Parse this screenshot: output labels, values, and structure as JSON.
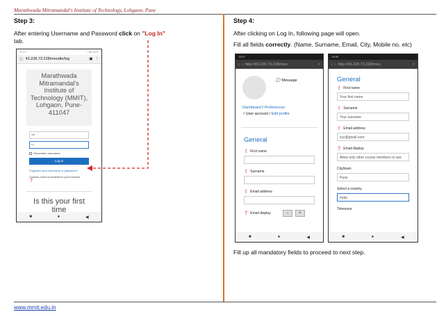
{
  "header": {
    "institute": "Marathwada Mitramandal's Institute of Technology, Lohgaon, Pune"
  },
  "footer": {
    "link": "www.mmit.edu.in"
  },
  "step3": {
    "title": "Step 3:",
    "text_pre": "After entering Username and Password ",
    "text_click": "click",
    "text_on": " on ",
    "text_login": "\"Log In\"",
    "text_post": " tab."
  },
  "step4": {
    "title": "Step 4:",
    "line1": "After clicking on Log In, following page will open.",
    "line2_pre": "Fill all fields ",
    "line2_bold": "correctly",
    "line2_post": ". (Name, Surname, Email, City, Mobile no. etc)",
    "bottom_note": "Fill up all mandatory fields to proceed to next step."
  },
  "phone1": {
    "status_time": "12:11",
    "status_right": "↑ ▮ 100%",
    "url": "43.228.73.228/moodle/log",
    "school": [
      "Marathwada",
      "Mitramandal's",
      "Institute of",
      "Technology (MMIT),",
      "Lohgaon, Pune-",
      "411047"
    ],
    "username_value": "mit",
    "password_value": "••|",
    "remember_label": "Remember username",
    "login_button": "Log in",
    "forgot_link": "Forgotten your username or password?",
    "cookie_note": "Cookies must be enabled in your browser",
    "first_time": "Is this your first time"
  },
  "phone2": {
    "status_time": "13:37",
    "url": "http://43.228.73.228/moo",
    "message_label": "Message",
    "breadcrumb": [
      "Dashboard",
      "Preferences",
      "User account",
      "Edit profile"
    ],
    "section": "General",
    "fields": [
      "First name",
      "Surname",
      "Email address",
      "Email display"
    ]
  },
  "phone3": {
    "status_time": "13:39",
    "url": "http://43.228.73.228/moo",
    "section": "General",
    "first_name_label": "First name",
    "first_name_value": "Your first name",
    "surname_label": "Surname",
    "surname_value": "Your surname",
    "email_label": "Email address",
    "email_value": "xyz@gmail.com",
    "display_label": "Email display",
    "display_value": "Allow only other course members to see",
    "city_label": "City/town",
    "city_value": "Pune",
    "country_label": "Select a country",
    "country_value": "India",
    "timezone_label": "Timezone"
  },
  "nav": {
    "back": "◀",
    "home": "●",
    "recent": "■"
  }
}
